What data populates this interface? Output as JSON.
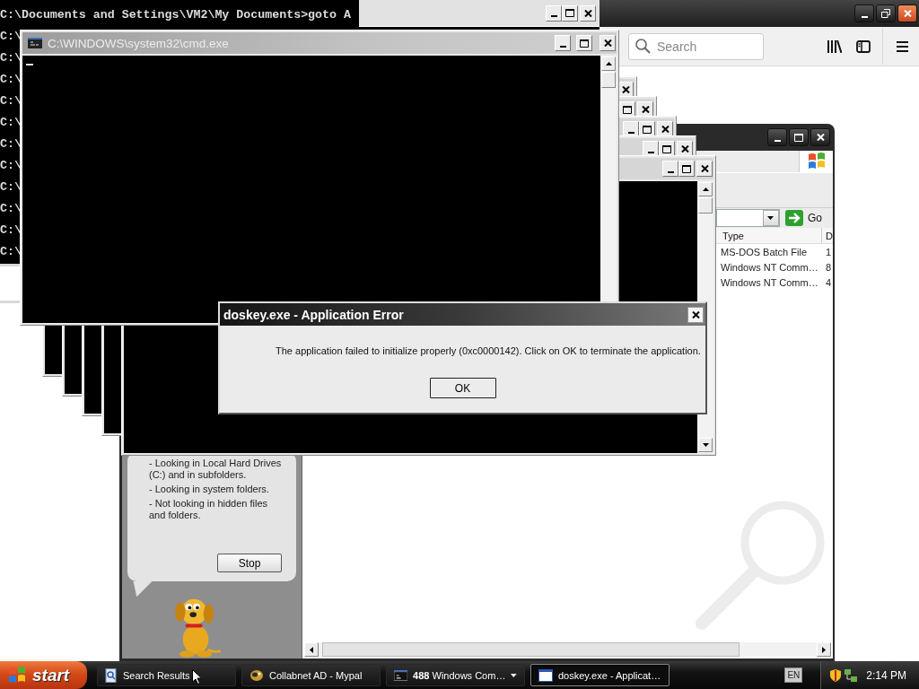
{
  "background_console": {
    "lines": [
      "C:\\Documents and Settings\\VM2\\My Documents>goto A",
      "C:\\",
      "C:\\",
      "C:\\",
      "C:\\",
      "C:\\",
      "C:\\",
      "C:\\",
      "C:\\",
      "C:\\",
      "C:\\",
      "C:\\"
    ]
  },
  "browser": {
    "search": {
      "placeholder": "Search"
    }
  },
  "explorer": {
    "go_button": "Go",
    "list": {
      "columns": [
        "Type",
        "D"
      ],
      "rows": [
        [
          "MS-DOS Batch File",
          "1"
        ],
        [
          "Windows NT Comm…",
          "8"
        ],
        [
          "Windows NT Comm…",
          "4"
        ]
      ]
    },
    "search_companion": {
      "status_lines": [
        "- Looking in Local Hard Drives (C:) and in subfolders.",
        "- Looking in system folders.",
        "- Not looking in hidden files and folders."
      ],
      "stop_button": "Stop"
    }
  },
  "cmd_window": {
    "title": "C:\\WINDOWS\\system32\\cmd.exe"
  },
  "error_dialog": {
    "title": "doskey.exe - Application Error",
    "message": "The application failed to initialize properly (0xc0000142). Click on OK to terminate the application.",
    "ok_button": "OK"
  },
  "taskbar": {
    "start_button": "start",
    "items": [
      {
        "kind": "search",
        "label": "Search Results",
        "selected": false
      },
      {
        "kind": "browser",
        "label": "Collabnet AD - Mypal",
        "selected": false
      },
      {
        "kind": "console",
        "count": "488",
        "label": "Windows Com…",
        "grouped": true,
        "selected": false
      },
      {
        "kind": "window",
        "label": "doskey.exe - Applicat…",
        "selected": true
      }
    ],
    "tray": {
      "language": "EN",
      "clock": "2:14 PM"
    }
  }
}
